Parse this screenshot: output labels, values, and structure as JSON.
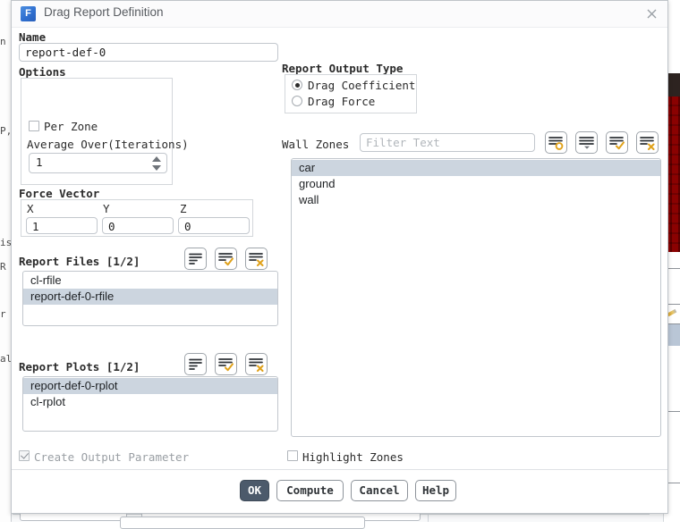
{
  "window": {
    "title": "Drag Report Definition",
    "app_icon": "fluent-f-icon",
    "close_icon": "close-icon"
  },
  "name_section": {
    "label": "Name",
    "value": "report-def-0",
    "placeholder": ""
  },
  "options_section": {
    "label": "Options",
    "per_zone": {
      "label": "Per Zone",
      "checked": false
    },
    "average_over": {
      "label": "Average Over(Iterations)",
      "value": "1"
    }
  },
  "force_vector": {
    "label": "Force Vector",
    "fields": [
      {
        "label": "X",
        "value": "1"
      },
      {
        "label": "Y",
        "value": "0"
      },
      {
        "label": "Z",
        "value": "0"
      }
    ]
  },
  "report_output_type": {
    "label": "Report Output Type",
    "options": [
      {
        "label": "Drag Coefficient",
        "selected": true
      },
      {
        "label": "Drag Force",
        "selected": false
      }
    ]
  },
  "wall_zones": {
    "label": "Wall Zones",
    "filter_placeholder": "Filter Text",
    "filter_value": "",
    "toolbar": [
      {
        "name": "new-selection-icon",
        "glyph": "list-circle"
      },
      {
        "name": "selection-helper-icon",
        "glyph": "list-dropdown"
      },
      {
        "name": "select-all-icon",
        "glyph": "list-check"
      },
      {
        "name": "deselect-all-icon",
        "glyph": "list-x"
      }
    ],
    "items": [
      {
        "label": "car",
        "selected": true
      },
      {
        "label": "ground",
        "selected": false
      },
      {
        "label": "wall",
        "selected": false
      }
    ]
  },
  "report_files": {
    "label": "Report Files [1/2]",
    "toolbar": [
      {
        "name": "list-icon",
        "glyph": "list-plain"
      },
      {
        "name": "select-all-icon",
        "glyph": "list-check"
      },
      {
        "name": "deselect-all-icon",
        "glyph": "list-x"
      }
    ],
    "items": [
      {
        "label": "cl-rfile",
        "selected": false
      },
      {
        "label": "report-def-0-rfile",
        "selected": true
      }
    ]
  },
  "report_plots": {
    "label": "Report Plots [1/2]",
    "toolbar": [
      {
        "name": "list-icon",
        "glyph": "list-plain"
      },
      {
        "name": "select-all-icon",
        "glyph": "list-check"
      },
      {
        "name": "deselect-all-icon",
        "glyph": "list-x"
      }
    ],
    "items": [
      {
        "label": "report-def-0-rplot",
        "selected": true
      },
      {
        "label": "cl-rplot",
        "selected": false
      }
    ]
  },
  "footer_checks": {
    "create_output_parameter": {
      "label": "Create Output Parameter",
      "checked": true,
      "disabled": true
    },
    "highlight_zones": {
      "label": "Highlight Zones",
      "checked": false,
      "disabled": false
    }
  },
  "buttons": {
    "ok": "OK",
    "compute": "Compute",
    "cancel": "Cancel",
    "help": "Help"
  },
  "background_fragments": {
    "left": [
      "n",
      "P,",
      "is",
      "R",
      "r",
      "al"
    ]
  },
  "colors": {
    "accent_gold": "#e0a21c",
    "selection": "#ccd5df",
    "primary_button": "#4c5a6b",
    "title_text": "#585c61",
    "mesh_red": "#c01a1a"
  }
}
